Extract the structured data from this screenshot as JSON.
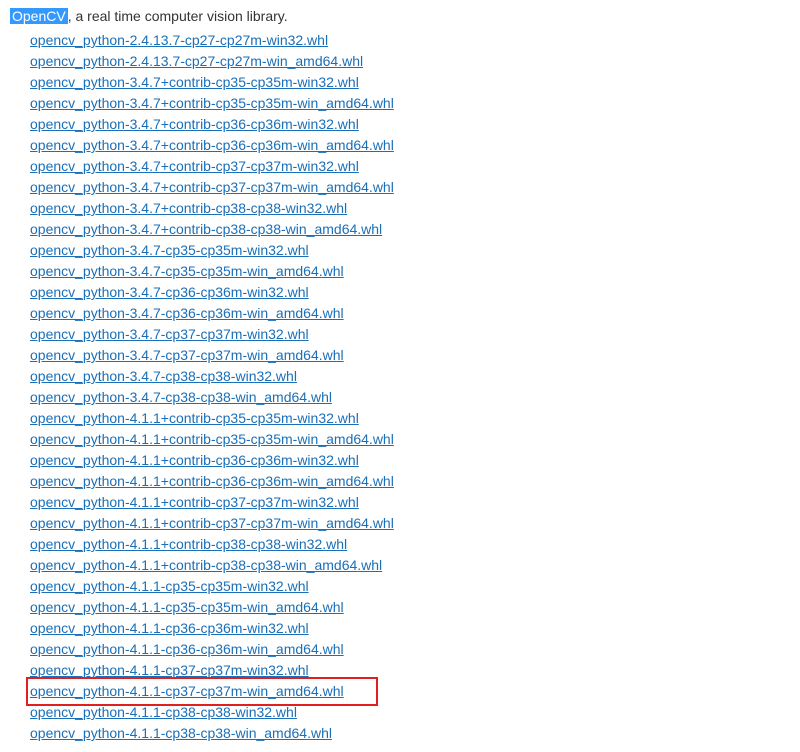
{
  "header": {
    "name": "OpenCV",
    "description": ", a real time computer vision library."
  },
  "files": [
    {
      "label": "opencv_python-2.4.13.7-cp27-cp27m-win32.whl"
    },
    {
      "label": "opencv_python-2.4.13.7-cp27-cp27m-win_amd64.whl"
    },
    {
      "label": "opencv_python-3.4.7+contrib-cp35-cp35m-win32.whl"
    },
    {
      "label": "opencv_python-3.4.7+contrib-cp35-cp35m-win_amd64.whl"
    },
    {
      "label": "opencv_python-3.4.7+contrib-cp36-cp36m-win32.whl"
    },
    {
      "label": "opencv_python-3.4.7+contrib-cp36-cp36m-win_amd64.whl"
    },
    {
      "label": "opencv_python-3.4.7+contrib-cp37-cp37m-win32.whl"
    },
    {
      "label": "opencv_python-3.4.7+contrib-cp37-cp37m-win_amd64.whl"
    },
    {
      "label": "opencv_python-3.4.7+contrib-cp38-cp38-win32.whl"
    },
    {
      "label": "opencv_python-3.4.7+contrib-cp38-cp38-win_amd64.whl"
    },
    {
      "label": "opencv_python-3.4.7-cp35-cp35m-win32.whl"
    },
    {
      "label": "opencv_python-3.4.7-cp35-cp35m-win_amd64.whl"
    },
    {
      "label": "opencv_python-3.4.7-cp36-cp36m-win32.whl"
    },
    {
      "label": "opencv_python-3.4.7-cp36-cp36m-win_amd64.whl"
    },
    {
      "label": "opencv_python-3.4.7-cp37-cp37m-win32.whl"
    },
    {
      "label": "opencv_python-3.4.7-cp37-cp37m-win_amd64.whl"
    },
    {
      "label": "opencv_python-3.4.7-cp38-cp38-win32.whl"
    },
    {
      "label": "opencv_python-3.4.7-cp38-cp38-win_amd64.whl"
    },
    {
      "label": "opencv_python-4.1.1+contrib-cp35-cp35m-win32.whl"
    },
    {
      "label": "opencv_python-4.1.1+contrib-cp35-cp35m-win_amd64.whl"
    },
    {
      "label": "opencv_python-4.1.1+contrib-cp36-cp36m-win32.whl"
    },
    {
      "label": "opencv_python-4.1.1+contrib-cp36-cp36m-win_amd64.whl"
    },
    {
      "label": "opencv_python-4.1.1+contrib-cp37-cp37m-win32.whl"
    },
    {
      "label": "opencv_python-4.1.1+contrib-cp37-cp37m-win_amd64.whl"
    },
    {
      "label": "opencv_python-4.1.1+contrib-cp38-cp38-win32.whl"
    },
    {
      "label": "opencv_python-4.1.1+contrib-cp38-cp38-win_amd64.whl"
    },
    {
      "label": "opencv_python-4.1.1-cp35-cp35m-win32.whl"
    },
    {
      "label": "opencv_python-4.1.1-cp35-cp35m-win_amd64.whl"
    },
    {
      "label": "opencv_python-4.1.1-cp36-cp36m-win32.whl"
    },
    {
      "label": "opencv_python-4.1.1-cp36-cp36m-win_amd64.whl"
    },
    {
      "label": "opencv_python-4.1.1-cp37-cp37m-win32.whl"
    },
    {
      "label": "opencv_python-4.1.1-cp37-cp37m-win_amd64.whl",
      "annotated": true
    },
    {
      "label": "opencv_python-4.1.1-cp38-cp38-win32.whl"
    },
    {
      "label": "opencv_python-4.1.1-cp38-cp38-win_amd64.whl"
    }
  ]
}
